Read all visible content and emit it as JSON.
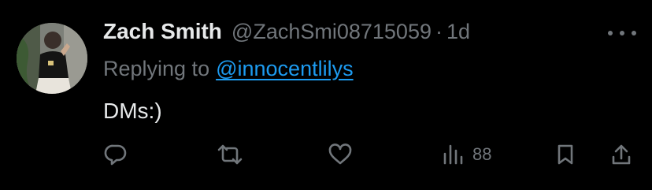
{
  "tweet": {
    "author_name": "Zach Smith",
    "author_handle": "@ZachSmi08715059",
    "separator": "·",
    "time_ago": "1d",
    "replying_prefix": "Replying to",
    "replying_to": "@innocentlilys",
    "text": "DMs:)"
  },
  "actions": {
    "reply_icon": "reply-icon",
    "retweet_icon": "retweet-icon",
    "like_icon": "heart-icon",
    "views_icon": "views-icon",
    "views_count": "88",
    "bookmark_icon": "bookmark-icon",
    "share_icon": "share-icon"
  },
  "colors": {
    "background": "#000000",
    "text_primary": "#e7e9ea",
    "text_secondary": "#71767b",
    "link": "#1d9bf0"
  }
}
